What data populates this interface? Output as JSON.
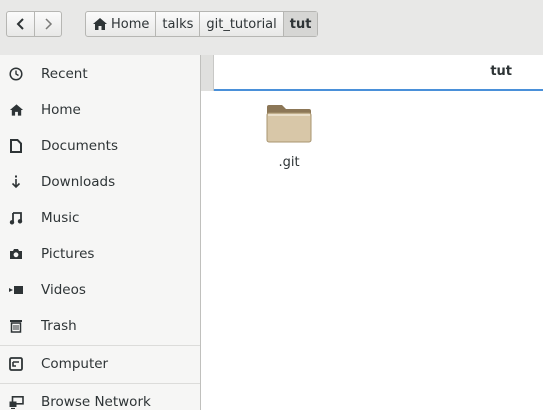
{
  "nav": {
    "back_icon": "chevron-left-icon",
    "forward_icon": "chevron-right-icon"
  },
  "breadcrumb": [
    {
      "label": "Home",
      "icon": "home-icon",
      "active": false
    },
    {
      "label": "talks",
      "active": false
    },
    {
      "label": "git_tutorial",
      "active": false
    },
    {
      "label": "tut",
      "active": true
    }
  ],
  "sidebar": {
    "items": [
      {
        "label": "Recent",
        "icon": "clock-icon"
      },
      {
        "label": "Home",
        "icon": "home-icon"
      },
      {
        "label": "Documents",
        "icon": "document-icon"
      },
      {
        "label": "Downloads",
        "icon": "download-icon"
      },
      {
        "label": "Music",
        "icon": "music-icon"
      },
      {
        "label": "Pictures",
        "icon": "camera-icon"
      },
      {
        "label": "Videos",
        "icon": "video-icon"
      },
      {
        "label": "Trash",
        "icon": "trash-icon"
      },
      {
        "label": "Computer",
        "icon": "computer-icon"
      },
      {
        "label": "Browse Network",
        "icon": "network-icon"
      }
    ]
  },
  "main": {
    "column_title": "tut",
    "files": [
      {
        "name": ".git",
        "icon": "folder-icon"
      }
    ]
  },
  "colors": {
    "accent": "#4a90d9",
    "folder": "#d8c7a8"
  }
}
